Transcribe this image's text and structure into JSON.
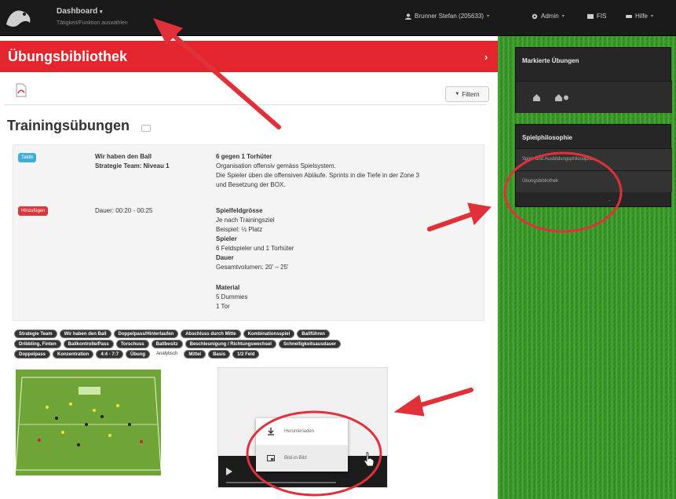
{
  "navbar": {
    "dashboard_label": "Dashboard",
    "dashboard_sub": "Tätigkeit/Funktion auswählen",
    "user_label": "Brunner Stefan (205633)",
    "admin_label": "Admin",
    "fis_label": "FIS",
    "help_label": "Hilfe"
  },
  "header": {
    "title": "Übungsbibliothek"
  },
  "toolbar": {
    "filter_label": "Filtern"
  },
  "section": {
    "title": "Trainingsübungen"
  },
  "card": {
    "badge_blue": "Taktik",
    "badge_red": "Hinzufügen",
    "col1_line1": "Wir haben den Ball",
    "col1_line2": "Strategie Team: Niveau 1",
    "duration": "Dauer: 00:20 - 00:25",
    "desc_title": "6 gegen 1 Torhüter",
    "desc_1": "Organisation offensiv gemäss Spielsystem.",
    "desc_2": "Die Spieler üben die offensiven Abläufe. Sprints in die Tiefe in der Zone 3",
    "desc_3": "und Besetzung der BOX.",
    "spielfeld_title": "Spielfeldgrösse",
    "spielfeld_1": "Je nach Trainingsziel",
    "spielfeld_2": "Beispiel: ½ Platz",
    "spieler_title": "Spieler",
    "spieler_1": "6 Feldspieler und 1 Torhüter",
    "dauer_title": "Dauer",
    "dauer_1": "Gesamtvolumen: 20' – 25'",
    "material_title": "Material",
    "material_1": "5 Dummies",
    "material_2": "1 Tor"
  },
  "tags": {
    "row1": [
      "Strategie Team",
      "Wir haben den Ball",
      "Doppelpass/Hinterlaufen",
      "Abschluss durch Mitte",
      "Kombinationsspiel",
      "Ballführen"
    ],
    "row2": [
      "Dribbling, Finten",
      "Ballkontrolle/Pass",
      "Torschuss",
      "Ballbesitz",
      "Beschleunigung / Richtungswechsel",
      "Schnelligkeitsausdauer"
    ],
    "row3": [
      "Doppelpass",
      "Konzentration",
      "4:4 - 7:7",
      "Übung",
      "Analytisch",
      "Mittel",
      "Basis",
      "1/2 Feld"
    ]
  },
  "video_menu": {
    "download": "Herunterladen",
    "pip": "Bild-in-Bild"
  },
  "sidebar": {
    "marked_title": "Markierte Übungen",
    "philosophy_title": "Spielphilosophie",
    "philosophy_item_1": "Spiel- und Ausbildungsphilosophie",
    "philosophy_item_2": "Übungsbibliothek"
  },
  "colors": {
    "brand_red": "#e3262e",
    "navbar": "#1a1a1a",
    "grass": "#3f9f2b",
    "annotation_red": "#e0313a"
  }
}
